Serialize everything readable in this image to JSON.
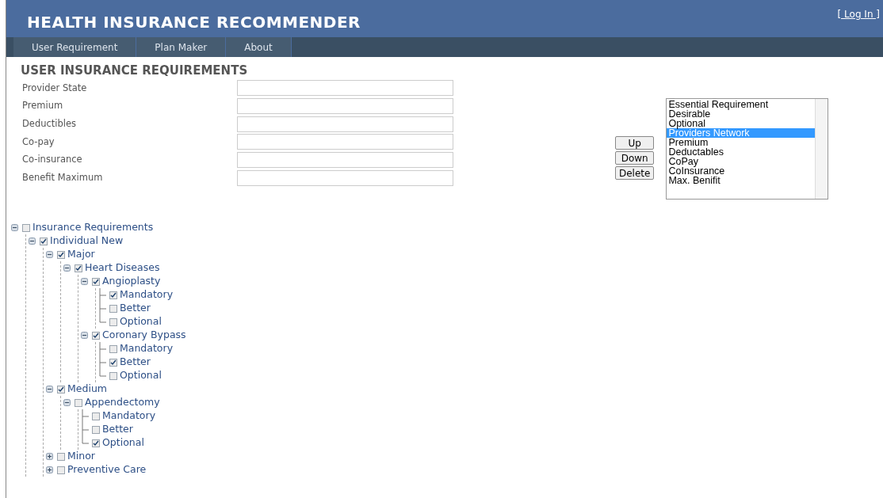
{
  "header": {
    "title": "HEALTH INSURANCE RECOMMENDER",
    "login": "[ Log In ]"
  },
  "nav": [
    {
      "label": "User Requirement"
    },
    {
      "label": "Plan Maker"
    },
    {
      "label": "About"
    }
  ],
  "form": {
    "title": "USER INSURANCE REQUIREMENTS",
    "fields": [
      {
        "label": "Provider State"
      },
      {
        "label": "Premium"
      },
      {
        "label": "Deductibles"
      },
      {
        "label": "Co-pay"
      },
      {
        "label": "Co-insurance"
      },
      {
        "label": "Benefit Maximum"
      }
    ]
  },
  "buttons": [
    "Up",
    "Down",
    "Delete"
  ],
  "priority_list": [
    {
      "label": "Essential Requirement",
      "selected": false
    },
    {
      "label": "Desirable",
      "selected": false
    },
    {
      "label": "Optional",
      "selected": false
    },
    {
      "label": "Providers Network",
      "selected": true
    },
    {
      "label": "Premium",
      "selected": false
    },
    {
      "label": "Deductables",
      "selected": false
    },
    {
      "label": "CoPay",
      "selected": false
    },
    {
      "label": "CoInsurance",
      "selected": false
    },
    {
      "label": "Max. Benifit",
      "selected": false
    }
  ],
  "tree": [
    {
      "label": "Insurance Requirements",
      "checked": false,
      "expanded": true,
      "children": [
        {
          "label": "Individual New",
          "checked": true,
          "expanded": true,
          "children": [
            {
              "label": "Major",
              "checked": true,
              "expanded": true,
              "children": [
                {
                  "label": "Heart Diseases",
                  "checked": true,
                  "expanded": true,
                  "children": [
                    {
                      "label": "Angioplasty",
                      "checked": true,
                      "expanded": true,
                      "children": [
                        {
                          "label": "Mandatory",
                          "checked": true
                        },
                        {
                          "label": "Better",
                          "checked": false
                        },
                        {
                          "label": "Optional",
                          "checked": false
                        }
                      ]
                    },
                    {
                      "label": "Coronary Bypass",
                      "checked": true,
                      "expanded": true,
                      "children": [
                        {
                          "label": "Mandatory",
                          "checked": false
                        },
                        {
                          "label": "Better",
                          "checked": true
                        },
                        {
                          "label": "Optional",
                          "checked": false
                        }
                      ]
                    }
                  ]
                }
              ]
            },
            {
              "label": "Medium",
              "checked": true,
              "expanded": true,
              "children": [
                {
                  "label": "Appendectomy",
                  "checked": false,
                  "expanded": true,
                  "children": [
                    {
                      "label": "Mandatory",
                      "checked": false
                    },
                    {
                      "label": "Better",
                      "checked": false
                    },
                    {
                      "label": "Optional",
                      "checked": true
                    }
                  ]
                }
              ]
            },
            {
              "label": "Minor",
              "checked": false,
              "expanded": false
            },
            {
              "label": "Preventive Care",
              "checked": false,
              "expanded": false
            }
          ]
        }
      ]
    }
  ]
}
